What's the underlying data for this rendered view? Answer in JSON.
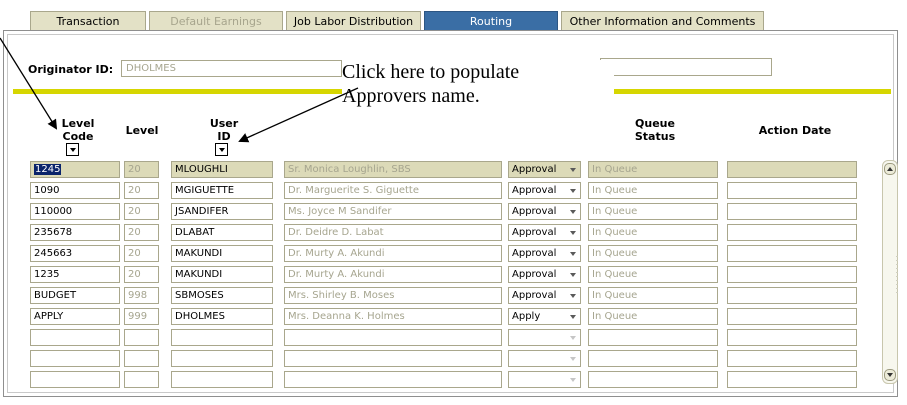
{
  "tabs": [
    {
      "label": "Transaction",
      "state": "normal"
    },
    {
      "label": "Default Earnings",
      "state": "disabled"
    },
    {
      "label": "Job Labor Distribution",
      "state": "normal"
    },
    {
      "label": "Routing",
      "state": "active"
    },
    {
      "label": "Other Information and Comments",
      "state": "normal"
    }
  ],
  "originator": {
    "label": "Originator ID:",
    "value": "DHOLMES"
  },
  "callout": {
    "line1": "Click here to populate",
    "line2": "Approvers name."
  },
  "columns": {
    "level_code": {
      "line1": "Level",
      "line2": "Code"
    },
    "level": "Level",
    "user_id": {
      "line1": "User",
      "line2": "ID"
    },
    "queue_status": {
      "line1": "Queue",
      "line2": "Status"
    },
    "action_date": "Action Date"
  },
  "rows": [
    {
      "level_code": "1245",
      "level": "20",
      "user_id": "MLOUGHLI",
      "name": "Sr. Monica Loughlin, SBS",
      "action": "Approval",
      "status": "In Queue"
    },
    {
      "level_code": "1090",
      "level": "20",
      "user_id": "MGIGUETTE",
      "name": "Dr. Marguerite S. Giguette",
      "action": "Approval",
      "status": "In Queue"
    },
    {
      "level_code": "110000",
      "level": "20",
      "user_id": "JSANDIFER",
      "name": "Ms. Joyce M Sandifer",
      "action": "Approval",
      "status": "In Queue"
    },
    {
      "level_code": "235678",
      "level": "20",
      "user_id": "DLABAT",
      "name": "Dr. Deidre D. Labat",
      "action": "Approval",
      "status": "In Queue"
    },
    {
      "level_code": "245663",
      "level": "20",
      "user_id": "MAKUNDI",
      "name": "Dr. Murty A. Akundi",
      "action": "Approval",
      "status": "In Queue"
    },
    {
      "level_code": "1235",
      "level": "20",
      "user_id": "MAKUNDI",
      "name": "Dr. Murty A. Akundi",
      "action": "Approval",
      "status": "In Queue"
    },
    {
      "level_code": "BUDGET",
      "level": "998",
      "user_id": "SBMOSES",
      "name": "Mrs. Shirley B. Moses",
      "action": "Approval",
      "status": "In Queue"
    },
    {
      "level_code": "APPLY",
      "level": "999",
      "user_id": "DHOLMES",
      "name": "Mrs. Deanna K. Holmes",
      "action": "Apply",
      "status": "In Queue"
    },
    {
      "level_code": "",
      "level": "",
      "user_id": "",
      "name": "",
      "action": "",
      "status": ""
    },
    {
      "level_code": "",
      "level": "",
      "user_id": "",
      "name": "",
      "action": "",
      "status": ""
    },
    {
      "level_code": "",
      "level": "",
      "user_id": "",
      "name": "",
      "action": "",
      "status": ""
    }
  ],
  "colors": {
    "tab_active": "#3a6ea5",
    "tab_bg": "#e3e1c6",
    "highlight_row": "#dcdab8",
    "accent_bar": "#d6d600",
    "selection": "#0a246a"
  }
}
